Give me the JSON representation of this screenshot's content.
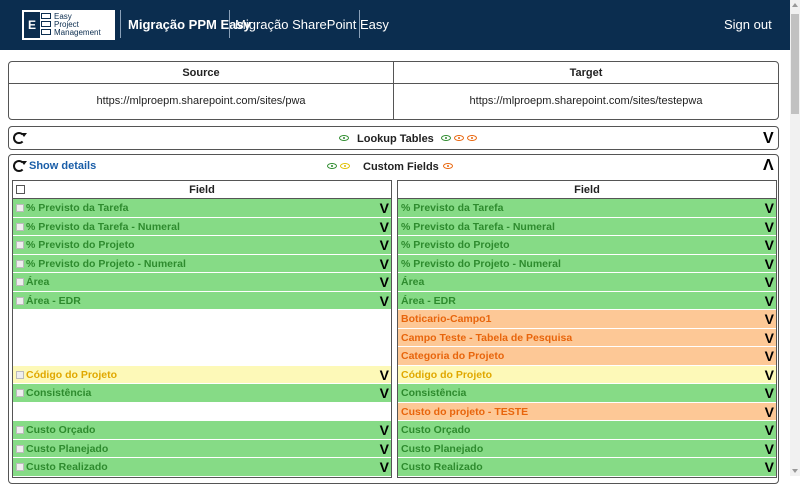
{
  "nav": {
    "logo_line1": "Easy",
    "logo_line2": "Project",
    "logo_line3": "Management",
    "brand": "Migração PPM Easy",
    "link": "Migração SharePoint Easy",
    "signout": "Sign out"
  },
  "sites": {
    "source_label": "Source",
    "target_label": "Target",
    "source_url": "https://mlproepm.sharepoint.com/sites/pwa",
    "target_url": "https://mlproepm.sharepoint.com/sites/testepwa"
  },
  "lookup": {
    "title": "Lookup Tables",
    "chevron": "V"
  },
  "custom": {
    "show_details": "Show details",
    "title": "Custom Fields",
    "chevron": "Λ",
    "left_header": "Field",
    "right_header": "Field",
    "left_rows": [
      {
        "label": "% Previsto da Tarefa",
        "status": "green",
        "chevron": "V"
      },
      {
        "label": "% Previsto da Tarefa - Numeral",
        "status": "green",
        "chevron": "V"
      },
      {
        "label": "% Previsto do Projeto",
        "status": "green",
        "chevron": "V"
      },
      {
        "label": "% Previsto do Projeto - Numeral",
        "status": "green",
        "chevron": "V"
      },
      {
        "label": "Área",
        "status": "green",
        "chevron": "V"
      },
      {
        "label": "Área - EDR",
        "status": "green",
        "chevron": "V"
      },
      {
        "label": "",
        "status": "empty",
        "chevron": ""
      },
      {
        "label": "",
        "status": "empty",
        "chevron": ""
      },
      {
        "label": "",
        "status": "empty",
        "chevron": ""
      },
      {
        "label": "Código do Projeto",
        "status": "yellow",
        "chevron": "V"
      },
      {
        "label": "Consistência",
        "status": "green",
        "chevron": "V"
      },
      {
        "label": "",
        "status": "empty",
        "chevron": ""
      },
      {
        "label": "Custo Orçado",
        "status": "green",
        "chevron": "V"
      },
      {
        "label": "Custo Planejado",
        "status": "green",
        "chevron": "V"
      },
      {
        "label": "Custo Realizado",
        "status": "green",
        "chevron": "V"
      }
    ],
    "right_rows": [
      {
        "label": "% Previsto da Tarefa",
        "status": "green",
        "chevron": "V"
      },
      {
        "label": "% Previsto da Tarefa - Numeral",
        "status": "green",
        "chevron": "V"
      },
      {
        "label": "% Previsto do Projeto",
        "status": "green",
        "chevron": "V"
      },
      {
        "label": "% Previsto do Projeto - Numeral",
        "status": "green",
        "chevron": "V"
      },
      {
        "label": "Área",
        "status": "green",
        "chevron": "V"
      },
      {
        "label": "Área - EDR",
        "status": "green",
        "chevron": "V"
      },
      {
        "label": "Boticario-Campo1",
        "status": "orange",
        "chevron": "V"
      },
      {
        "label": "Campo Teste - Tabela de Pesquisa",
        "status": "orange",
        "chevron": "V"
      },
      {
        "label": "Categoria do Projeto",
        "status": "orange",
        "chevron": "V"
      },
      {
        "label": "Código do Projeto",
        "status": "yellow",
        "chevron": "V"
      },
      {
        "label": "Consistência",
        "status": "green",
        "chevron": "V"
      },
      {
        "label": "Custo do projeto - TESTE",
        "status": "orange",
        "chevron": "V"
      },
      {
        "label": "Custo Orçado",
        "status": "green",
        "chevron": "V"
      },
      {
        "label": "Custo Planejado",
        "status": "green",
        "chevron": "V"
      },
      {
        "label": "Custo Realizado",
        "status": "green",
        "chevron": "V"
      }
    ]
  },
  "colors": {
    "navbar": "#0b2d4f",
    "green_row": "#86db86",
    "green_text": "#2e8b2e",
    "yellow_row": "#fdf9b8",
    "yellow_text": "#e0a800",
    "orange_row": "#fdc896",
    "orange_text": "#e8650c",
    "link": "#1a5ea8"
  }
}
